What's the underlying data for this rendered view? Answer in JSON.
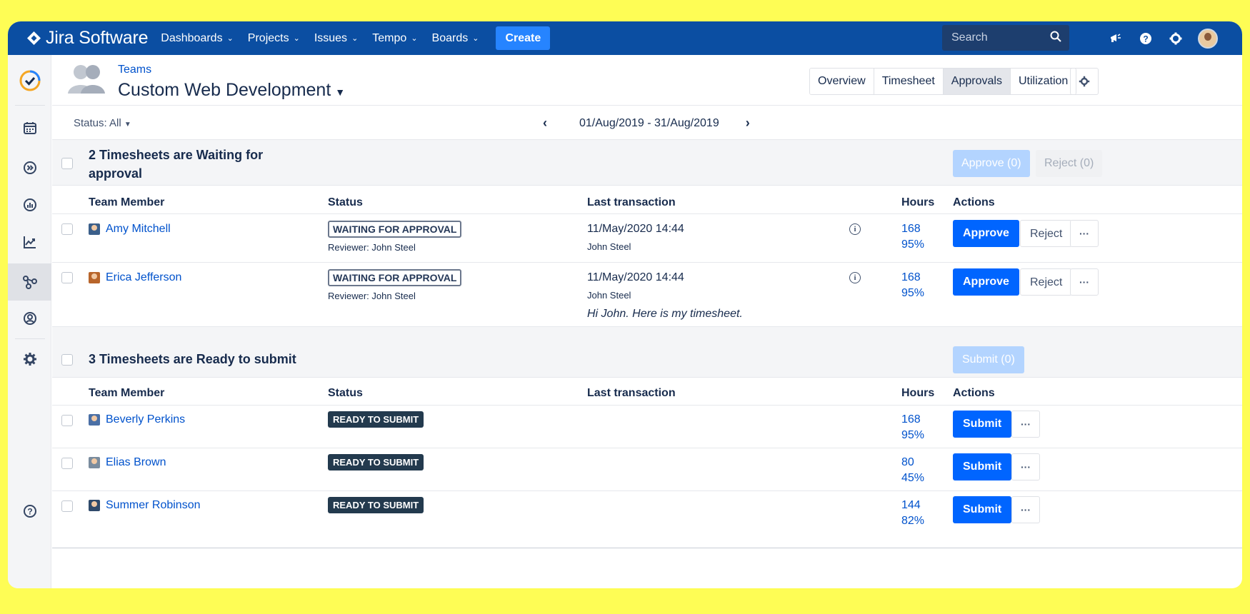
{
  "topnav": {
    "brand": "Jira Software",
    "items": [
      "Dashboards",
      "Projects",
      "Issues",
      "Tempo",
      "Boards"
    ],
    "create_label": "Create",
    "search_placeholder": "Search"
  },
  "header": {
    "breadcrumb": "Teams",
    "team_name": "Custom Web Development",
    "tabs": [
      "Overview",
      "Timesheet",
      "Approvals",
      "Utilization"
    ],
    "active_tab": "Approvals"
  },
  "filter": {
    "status_label": "Status: All",
    "date_range": "01/Aug/2019 - 31/Aug/2019"
  },
  "columns": {
    "member": "Team Member",
    "status": "Status",
    "last_transaction": "Last transaction",
    "hours": "Hours",
    "actions": "Actions"
  },
  "waiting": {
    "title_line1": "2 Timesheets are Waiting for",
    "title_line2": "approval",
    "approve_all": "Approve (0)",
    "reject_all": "Reject (0)",
    "rows": [
      {
        "name": "Amy Mitchell",
        "status": "WAITING FOR APPROVAL",
        "reviewer": "Reviewer: John Steel",
        "date": "11/May/2020 14:44",
        "by": "John Steel",
        "note": "",
        "hours": "168",
        "percent": "95%",
        "approve": "Approve",
        "reject": "Reject",
        "more": "···",
        "avatar_color": "#3b5f8a"
      },
      {
        "name": "Erica Jefferson",
        "status": "WAITING FOR APPROVAL",
        "reviewer": "Reviewer: John Steel",
        "date": "11/May/2020 14:44",
        "by": "John Steel",
        "note": "Hi John. Here is my timesheet.",
        "hours": "168",
        "percent": "95%",
        "approve": "Approve",
        "reject": "Reject",
        "more": "···",
        "avatar_color": "#b8652b"
      }
    ]
  },
  "ready": {
    "title": "3 Timesheets are Ready to submit",
    "submit_all": "Submit (0)",
    "rows": [
      {
        "name": "Beverly Perkins",
        "status": "READY TO SUBMIT",
        "hours": "168",
        "percent": "95%",
        "submit": "Submit",
        "more": "···",
        "avatar_color": "#4a6fa5"
      },
      {
        "name": "Elias Brown",
        "status": "READY TO SUBMIT",
        "hours": "80",
        "percent": "45%",
        "submit": "Submit",
        "more": "···",
        "avatar_color": "#7a8c9e"
      },
      {
        "name": "Summer Robinson",
        "status": "READY TO SUBMIT",
        "hours": "144",
        "percent": "82%",
        "submit": "Submit",
        "more": "···",
        "avatar_color": "#2f4a6b"
      }
    ]
  },
  "colors": {
    "nav_bg": "#0b4ea2",
    "primary": "#0065ff",
    "link": "#0052cc",
    "ready_lozenge": "#233a4e",
    "frame": "#fefd55"
  }
}
